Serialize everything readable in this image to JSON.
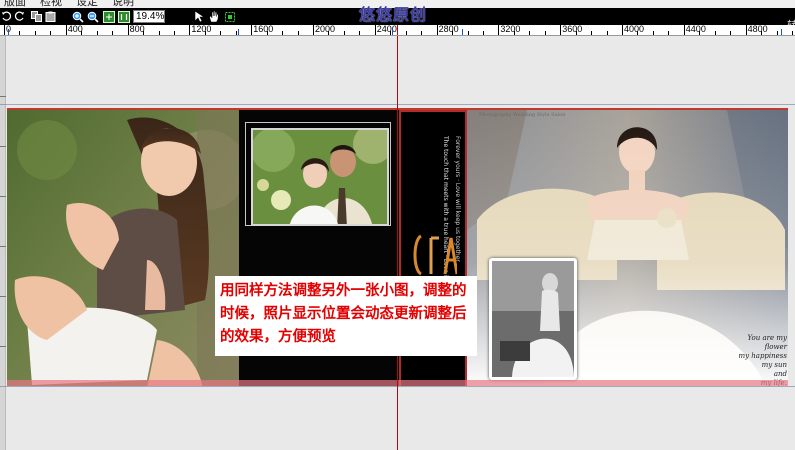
{
  "menu": {
    "items": [
      "版面",
      "检视",
      "设定",
      "说明"
    ]
  },
  "toolbar": {
    "zoom_value": "19.4%",
    "watermark": "悠悠原创",
    "right_fragment": "转"
  },
  "ruler": {
    "labels": [
      "0",
      "400",
      "800",
      "1200",
      "1600",
      "2000",
      "2400",
      "2800",
      "3200",
      "3600",
      "4000",
      "4400",
      "4800"
    ]
  },
  "spread": {
    "vertical_text_1": "The touch that meets with a true heart · Love is patient",
    "vertical_text_2": "Forever yours · Love will keep us together",
    "top_script": "Photography Wedding Style Salon",
    "poem": [
      "You are my flower",
      "my happiness",
      "my sun",
      "and",
      "my life."
    ]
  },
  "caption": {
    "text": "用同样方法调整另外一张小图，调整的时候，照片显示位置会动态更新调整后的效果，方便预览"
  },
  "colors": {
    "caption_text": "#e30000",
    "toolbar_bg": "#000000",
    "watermark": "#3a3aa8",
    "selection_frame": "#b22a2a",
    "center_guide": "#a01010"
  }
}
